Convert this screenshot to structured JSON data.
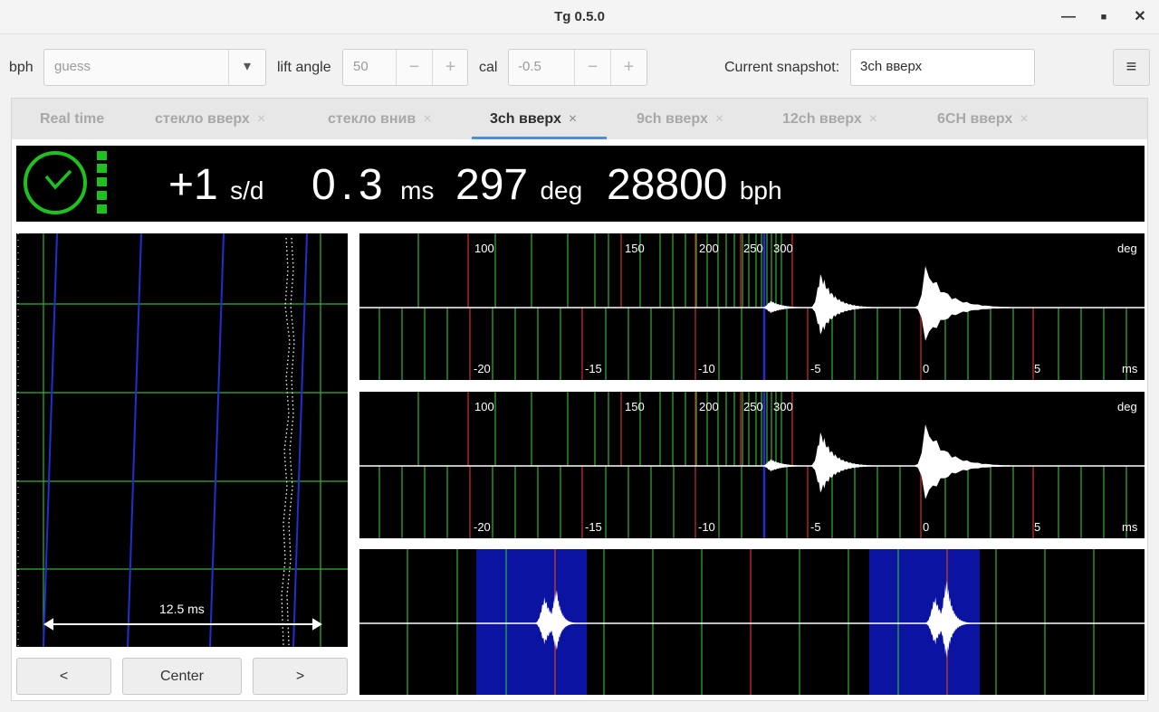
{
  "window": {
    "title": "Tg 0.5.0",
    "minimize_glyph": "—",
    "maximize_glyph": "■",
    "close_glyph": "✕"
  },
  "toolbar": {
    "bph_label": "bph",
    "bph_placeholder": "guess",
    "lift_angle_label": "lift angle",
    "lift_angle_value": "50",
    "cal_label": "cal",
    "cal_value": "-0.5",
    "minus_glyph": "−",
    "plus_glyph": "+",
    "dropdown_glyph": "▾",
    "snapshot_label": "Current snapshot:",
    "snapshot_value": "3ch вверх",
    "menu_glyph": "≡"
  },
  "tabs": [
    {
      "label": "Real time",
      "closable": false,
      "active": false
    },
    {
      "label": "стекло вверх",
      "closable": true,
      "active": false
    },
    {
      "label": "стекло внив",
      "closable": true,
      "active": false
    },
    {
      "label": "3ch вверх",
      "closable": true,
      "active": true
    },
    {
      "label": "9ch вверх",
      "closable": true,
      "active": false
    },
    {
      "label": "12ch вверх",
      "closable": true,
      "active": false
    },
    {
      "label": "6CH вверх",
      "closable": true,
      "active": false
    }
  ],
  "tab_close_glyph": "×",
  "readout": {
    "rate_value": "+1",
    "rate_unit": "s/d",
    "beat_error_value": "0.3",
    "beat_error_unit": "ms",
    "amplitude_value": "297",
    "amplitude_unit": "deg",
    "bph_value": "28800",
    "bph_unit": "bph",
    "status_color": "#1fc11f"
  },
  "paperstrip": {
    "scale_label": "12.5 ms"
  },
  "waveforms": {
    "deg_labels": [
      "100",
      "150",
      "200",
      "250",
      "300"
    ],
    "deg_unit": "deg",
    "ms_labels": [
      "-20",
      "-15",
      "-10",
      "-5",
      "0",
      "5"
    ],
    "ms_unit": "ms"
  },
  "buttons": {
    "prev_label": "<",
    "center_label": "Center",
    "next_label": ">"
  },
  "colors": {
    "grid_green": "#35b035",
    "grid_red": "#d03030",
    "trace_blue": "#1f2fd0",
    "highlight_blue": "#0a14a0"
  }
}
